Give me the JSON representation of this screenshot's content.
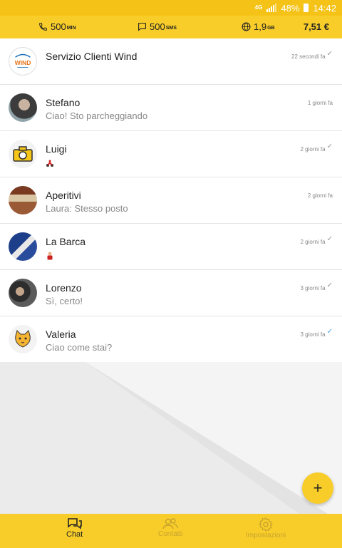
{
  "status_bar": {
    "network": "4G",
    "battery": "48%",
    "time": "14:42"
  },
  "top_bar": {
    "minutes_value": "500",
    "minutes_unit": "MIN",
    "sms_value": "500",
    "sms_unit": "SMS",
    "data_value": "1,9",
    "data_unit": "GB",
    "credit": "7,51 €"
  },
  "chats": [
    {
      "name": "Servizio Clienti Wind",
      "preview": "",
      "time": "22 secondi fa",
      "status": "read",
      "avatar_icon": "wind-logo-icon",
      "avatar_text": "WIND"
    },
    {
      "name": "Stefano",
      "preview": "Ciao! Sto parcheggiando",
      "time": "1 giorni fa",
      "status": "",
      "avatar_icon": "user-photo-icon"
    },
    {
      "name": "Luigi",
      "preview": "",
      "time": "2 giorni fa",
      "status": "read",
      "avatar_icon": "camera-icon",
      "preview_icon": "motorbike-emoji-icon"
    },
    {
      "name": "Aperitivi",
      "preview": "Laura: Stesso posto",
      "time": "2 giorni fa",
      "status": "",
      "avatar_icon": "group-photo-icon"
    },
    {
      "name": "La Barca",
      "preview": "",
      "time": "2 giorni fa",
      "status": "read",
      "avatar_icon": "sail-photo-icon",
      "preview_icon": "person-emoji-icon"
    },
    {
      "name": "Lorenzo",
      "preview": "Sì, certo!",
      "time": "3 giorni fa",
      "status": "read",
      "avatar_icon": "user-photo-icon"
    },
    {
      "name": "Valeria",
      "preview": "Ciao come stai?",
      "time": "3 giorni fa",
      "status": "delivered",
      "avatar_icon": "cat-emoji-icon"
    }
  ],
  "fab": {
    "label": "+"
  },
  "bottom_nav": [
    {
      "label": "Chat",
      "icon": "chat-icon",
      "active": true
    },
    {
      "label": "Contatti",
      "icon": "contacts-icon",
      "active": false
    },
    {
      "label": "Impostazioni",
      "icon": "gear-icon",
      "active": false
    }
  ],
  "colors": {
    "accent": "#f8cd2a",
    "status_bar": "#f5c318",
    "read_check": "#4aa3e6"
  }
}
